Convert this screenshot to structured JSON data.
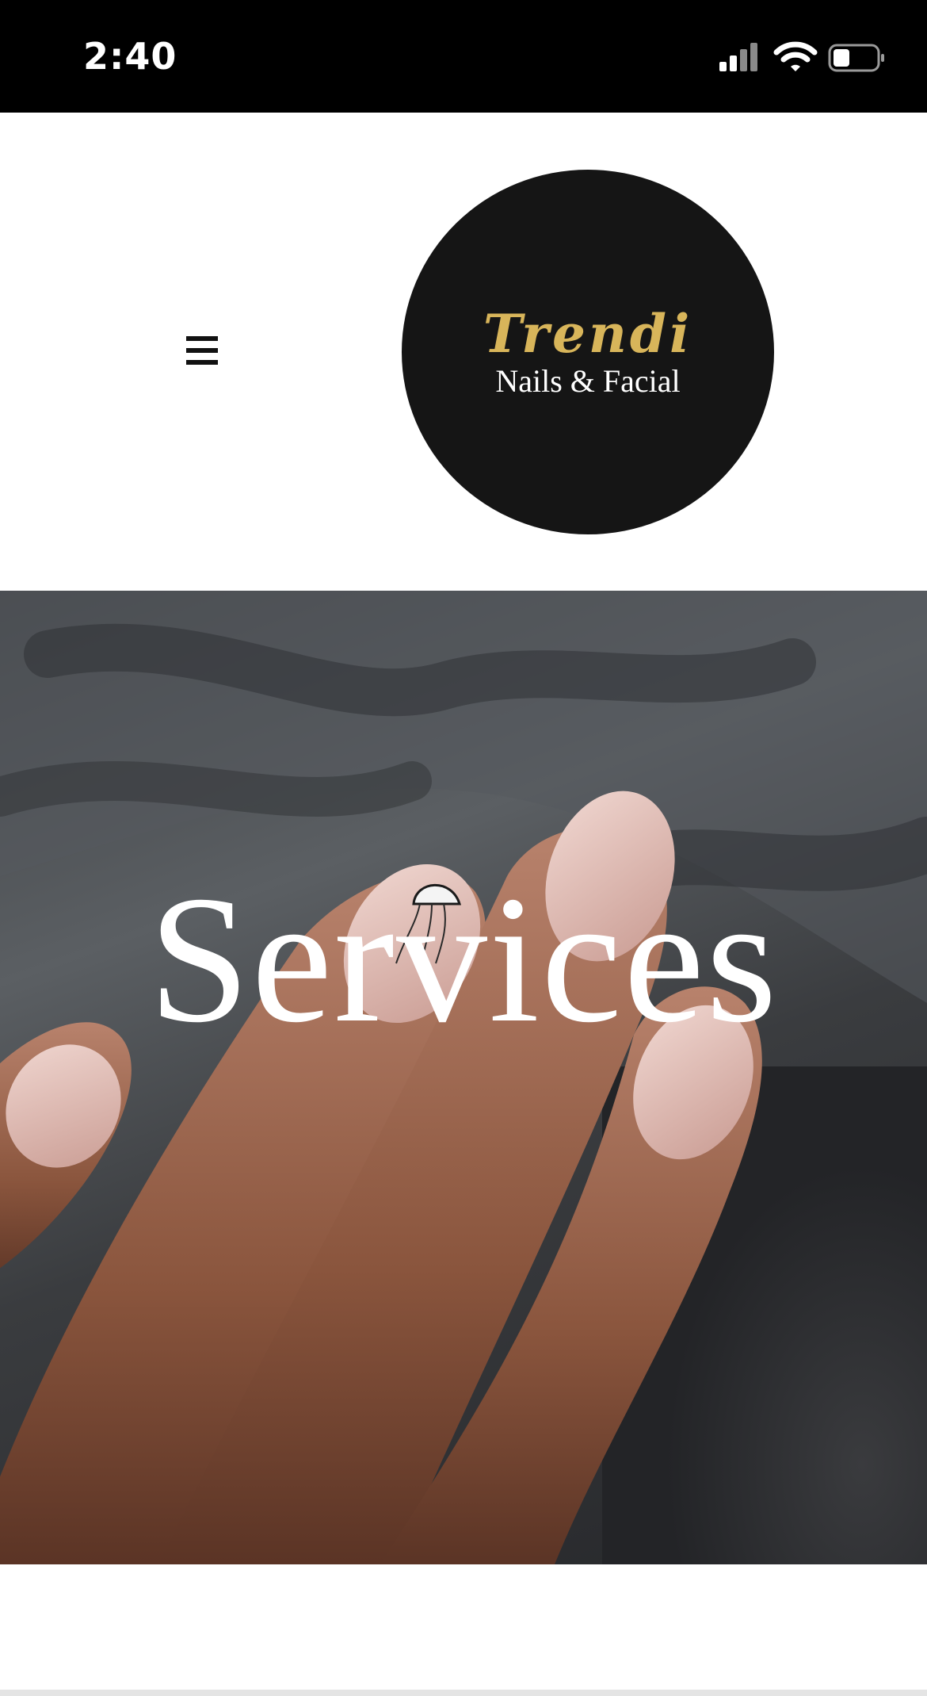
{
  "status_bar": {
    "time": "2:40",
    "icons": [
      "cellular-signal-icon",
      "wifi-icon",
      "battery-icon"
    ]
  },
  "header": {
    "menu_icon": "hamburger-menu-icon",
    "logo": {
      "line1": "Trendi",
      "line2": "Nails & Facial",
      "colors": {
        "background": "#151515",
        "accent": "#d8b55a",
        "text": "#ffffff"
      }
    }
  },
  "hero": {
    "title": "Services",
    "image": "close-up of a hand with nude manicured nails, one nail with jellyfish nail art, on grey knit fabric"
  }
}
